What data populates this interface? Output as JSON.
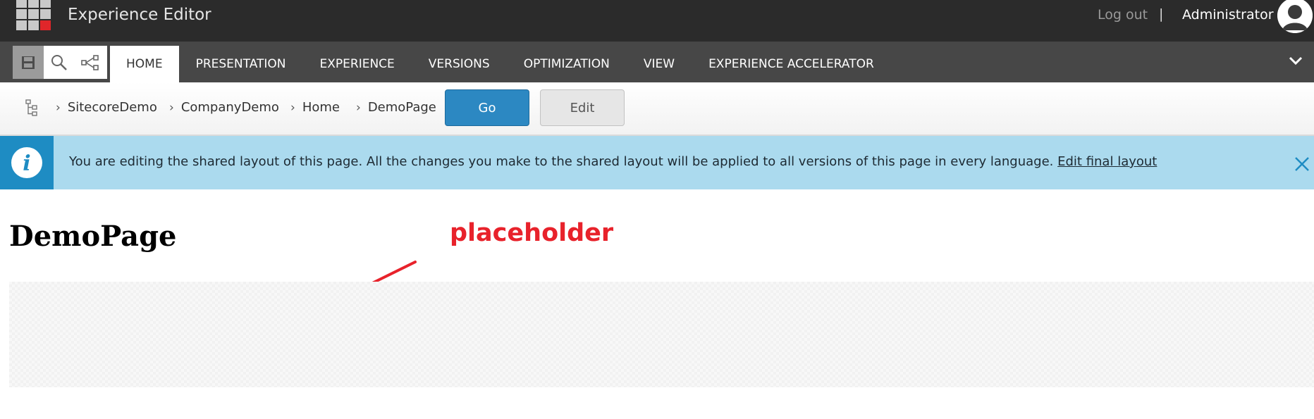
{
  "app": {
    "title": "Experience Editor"
  },
  "user": {
    "logout_label": "Log out",
    "separator": "|",
    "name": "Administrator"
  },
  "ribbon": {
    "tabs": [
      {
        "label": "HOME",
        "active": true
      },
      {
        "label": "PRESENTATION"
      },
      {
        "label": "EXPERIENCE"
      },
      {
        "label": "VERSIONS"
      },
      {
        "label": "OPTIMIZATION"
      },
      {
        "label": "VIEW"
      },
      {
        "label": "EXPERIENCE ACCELERATOR"
      }
    ],
    "quick_actions": [
      "save-icon",
      "search-icon",
      "share-icon"
    ]
  },
  "breadcrumb": {
    "items": [
      "SitecoreDemo",
      "CompanyDemo",
      "Home",
      "DemoPage"
    ],
    "go_label": "Go",
    "edit_label": "Edit"
  },
  "banner": {
    "message": "You are editing the shared layout of this page. All the changes you make to the shared layout will be applied to all versions of this page in every language.",
    "link_label": "Edit final layout"
  },
  "page": {
    "heading": "DemoPage",
    "annotation_label": "placeholder"
  },
  "colors": {
    "topbar": "#2b2b2b",
    "ribbon": "#474747",
    "go_button": "#2c88c2",
    "banner": "#abdaee",
    "annotation": "#e8222b"
  }
}
